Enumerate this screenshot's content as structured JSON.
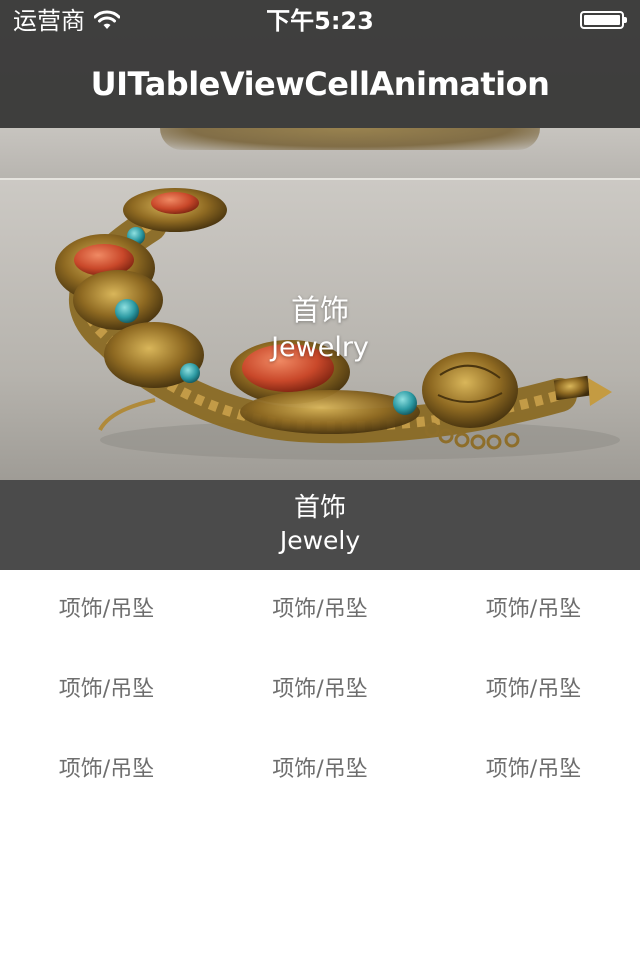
{
  "status_bar": {
    "carrier": "运营商",
    "time": "下午5:23",
    "wifi_icon": "wifi-icon",
    "battery_icon": "battery-icon"
  },
  "nav": {
    "title": "UITableViewCellAnimation"
  },
  "banner": {
    "title": "首饰",
    "subtitle": "Jewelry"
  },
  "category": {
    "title": "首饰",
    "subtitle": "Jewely"
  },
  "grid": {
    "items": [
      "项饰/吊坠",
      "项饰/吊坠",
      "项饰/吊坠",
      "项饰/吊坠",
      "项饰/吊坠",
      "项饰/吊坠",
      "项饰/吊坠",
      "项饰/吊坠",
      "项饰/吊坠"
    ]
  },
  "colors": {
    "nav_background": "#282828",
    "category_background": "#4b4b4b",
    "grid_text": "#6e6e6e"
  }
}
